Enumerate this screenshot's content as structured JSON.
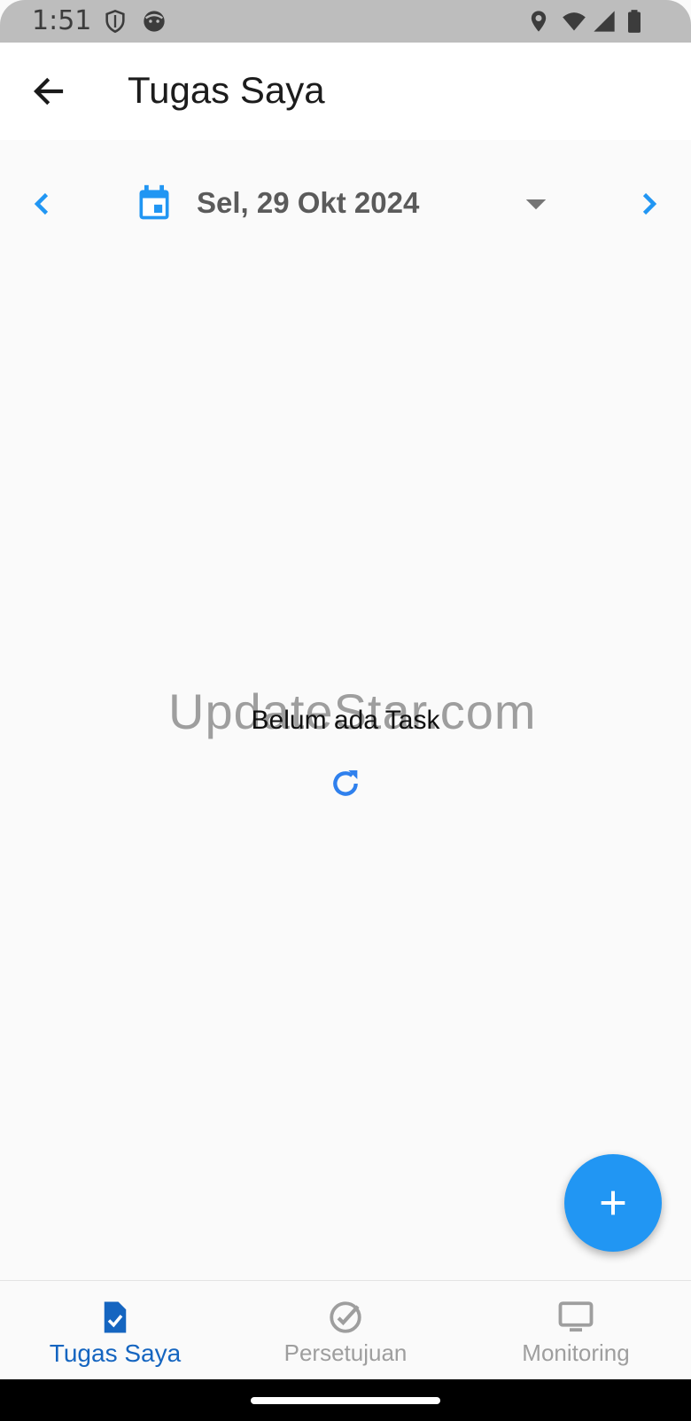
{
  "status_bar": {
    "time": "1:51",
    "icons": [
      "shield-icon",
      "face-icon",
      "location-icon",
      "wifi-icon",
      "signal-icon",
      "battery-icon"
    ]
  },
  "app_bar": {
    "title": "Tugas Saya",
    "back_icon": "arrow-back-icon"
  },
  "date_selector": {
    "date_label": "Sel, 29 Okt 2024",
    "prev_icon": "chevron-left-icon",
    "next_icon": "chevron-right-icon",
    "calendar_icon": "calendar-icon",
    "dropdown_icon": "arrow-drop-down-icon"
  },
  "content": {
    "empty_message": "Belum ada Task",
    "watermark": "UpdateStar.com",
    "refresh_icon": "refresh-icon"
  },
  "fab": {
    "icon": "plus-icon"
  },
  "bottom_nav": {
    "items": [
      {
        "label": "Tugas Saya",
        "icon": "task-icon",
        "active": true
      },
      {
        "label": "Persetujuan",
        "icon": "check-circle-icon",
        "active": false
      },
      {
        "label": "Monitoring",
        "icon": "monitor-icon",
        "active": false
      }
    ]
  },
  "colors": {
    "accent": "#2196f3",
    "active_nav": "#1565c0",
    "inactive_nav": "#9e9e9e",
    "status_bar": "#bdbdbd",
    "background": "#fafafa"
  }
}
